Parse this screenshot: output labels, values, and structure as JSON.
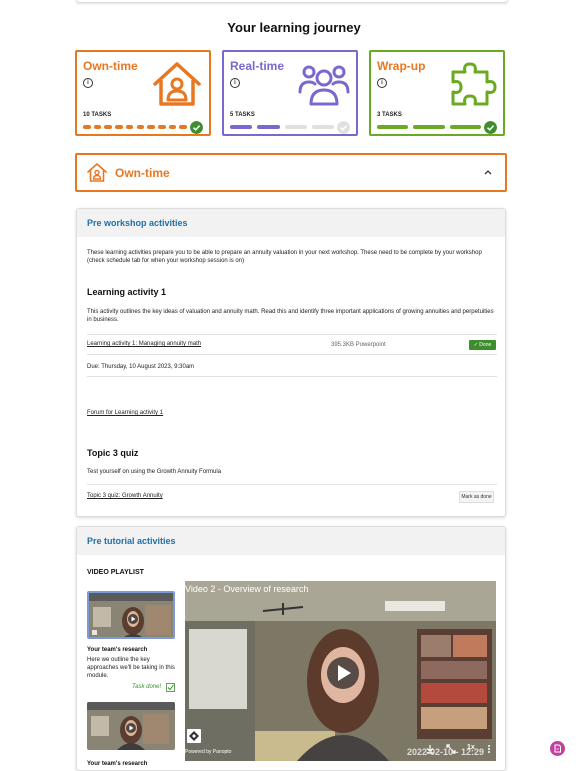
{
  "page": {
    "title": "Your learning journey"
  },
  "journey": [
    {
      "name": "Own-time",
      "tasks_label": "10 TASKS",
      "color": "#e87722",
      "icon": "house-person-icon",
      "segments_total": 10,
      "segments_done": 10,
      "complete": true
    },
    {
      "name": "Real-time",
      "tasks_label": "5 TASKS",
      "color": "#7b68cf",
      "icon": "group-people-icon",
      "segments_total": 4,
      "segments_done": 2,
      "complete": false
    },
    {
      "name": "Wrap-up",
      "tasks_label": "3 TASKS",
      "color": "#6aaa22",
      "icon": "puzzle-piece-icon",
      "segments_total": 3,
      "segments_done": 3,
      "complete": true
    }
  ],
  "accordion": {
    "label": "Own-time",
    "expanded": true
  },
  "pre_workshop": {
    "heading": "Pre workshop activities",
    "intro": "These learning activities prepare you to be able to prepare an annuity valuation in your next workshop. These need to be complete by your workshop (check schedule tab for when your workshop session is on)",
    "activity1": {
      "title": "Learning activity 1",
      "description": "This activity outlines the key ideas of valuation and annuity math. Read this and identify three important applications of growing annuities and perpetuities in business.",
      "link": "Learning activity 1: Managing annuity math",
      "file_info": "395.3KB Powerpoint",
      "status": "✓ Done",
      "due": "Due: Thursday, 10 August 2023, 9:30am",
      "forum_link": "Forum for Learning activity 1"
    },
    "quiz": {
      "title": "Topic 3 quiz",
      "description": "Test yourself on using the Growth Annuity Formula",
      "link": "Topic 3 quiz: Growth Annuity",
      "button": "Mark as done"
    }
  },
  "pre_tutorial": {
    "heading": "Pre tutorial activities",
    "playlist_label": "VIDEO PLAYLIST",
    "items": [
      {
        "title": "Your team's research",
        "desc": "Here we outline the key approaches we'll be taking in this module.",
        "status": "Task done!"
      },
      {
        "title": "Your team's research"
      }
    ],
    "video": {
      "title": "Video 2 - Overview of research",
      "date": "2022-02-10 - 12:29",
      "powered": "Powered by Panopto",
      "speed": "1x"
    }
  }
}
